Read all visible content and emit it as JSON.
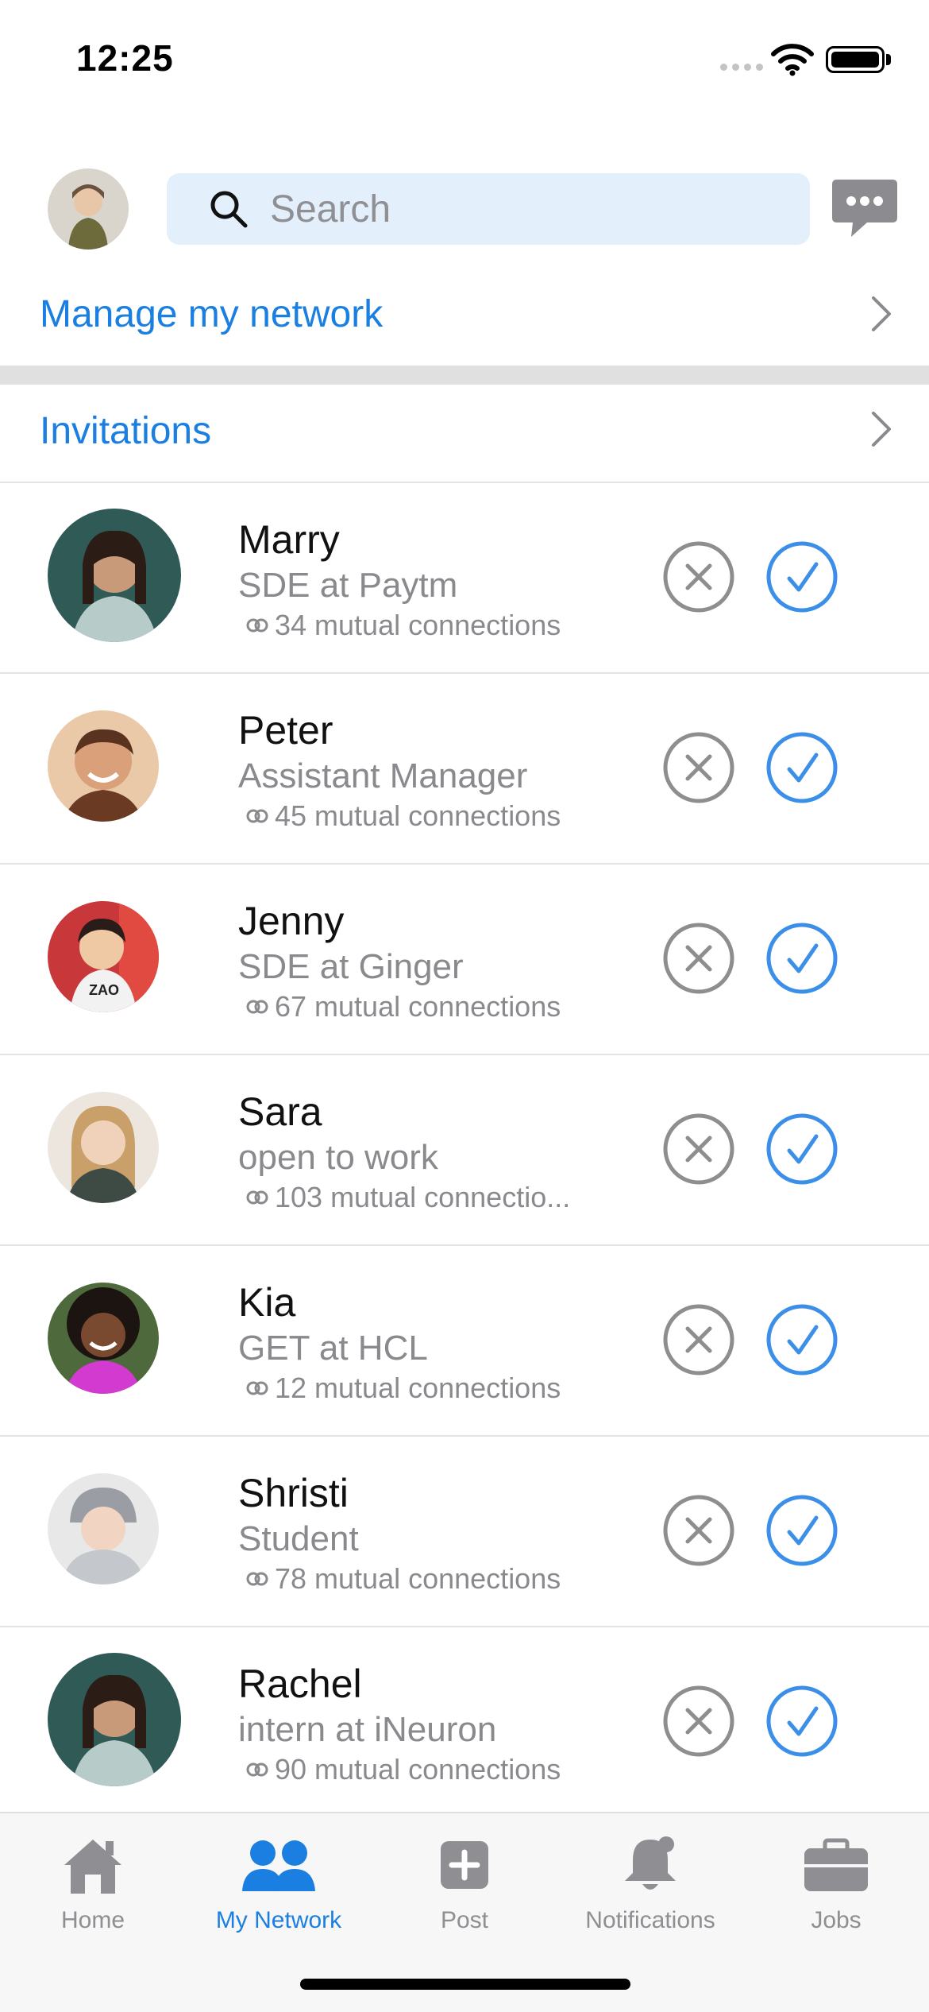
{
  "status_bar": {
    "time": "12:25"
  },
  "search": {
    "placeholder": "Search"
  },
  "links": {
    "manage_network": "Manage my network",
    "invitations": "Invitations"
  },
  "invitations": [
    {
      "name": "Marry",
      "title": "SDE at Paytm",
      "mutual": "34 mutual connections"
    },
    {
      "name": "Peter",
      "title": "Assistant Manager",
      "mutual": "45 mutual connections"
    },
    {
      "name": "Jenny",
      "title": "SDE at Ginger",
      "mutual": "67 mutual connections"
    },
    {
      "name": "Sara",
      "title": "open to work",
      "mutual": "103 mutual connectio..."
    },
    {
      "name": "Kia",
      "title": "GET at HCL",
      "mutual": "12 mutual connections"
    },
    {
      "name": "Shristi",
      "title": "Student",
      "mutual": "78 mutual connections"
    },
    {
      "name": "Rachel",
      "title": "intern at iNeuron",
      "mutual": "90 mutual connections"
    }
  ],
  "tabs": [
    {
      "label": "Home",
      "icon": "home-icon",
      "active": false
    },
    {
      "label": "My Network",
      "icon": "people-icon",
      "active": true
    },
    {
      "label": "Post",
      "icon": "plus-square-icon",
      "active": false
    },
    {
      "label": "Notifications",
      "icon": "bell-icon",
      "active": false
    },
    {
      "label": "Jobs",
      "icon": "briefcase-icon",
      "active": false
    }
  ],
  "colors": {
    "accent": "#1a7fe0",
    "muted": "#8a8a8e",
    "search_bg": "#e3f0fc",
    "accept": "#3b8fe8",
    "decline": "#8e8e8e"
  }
}
